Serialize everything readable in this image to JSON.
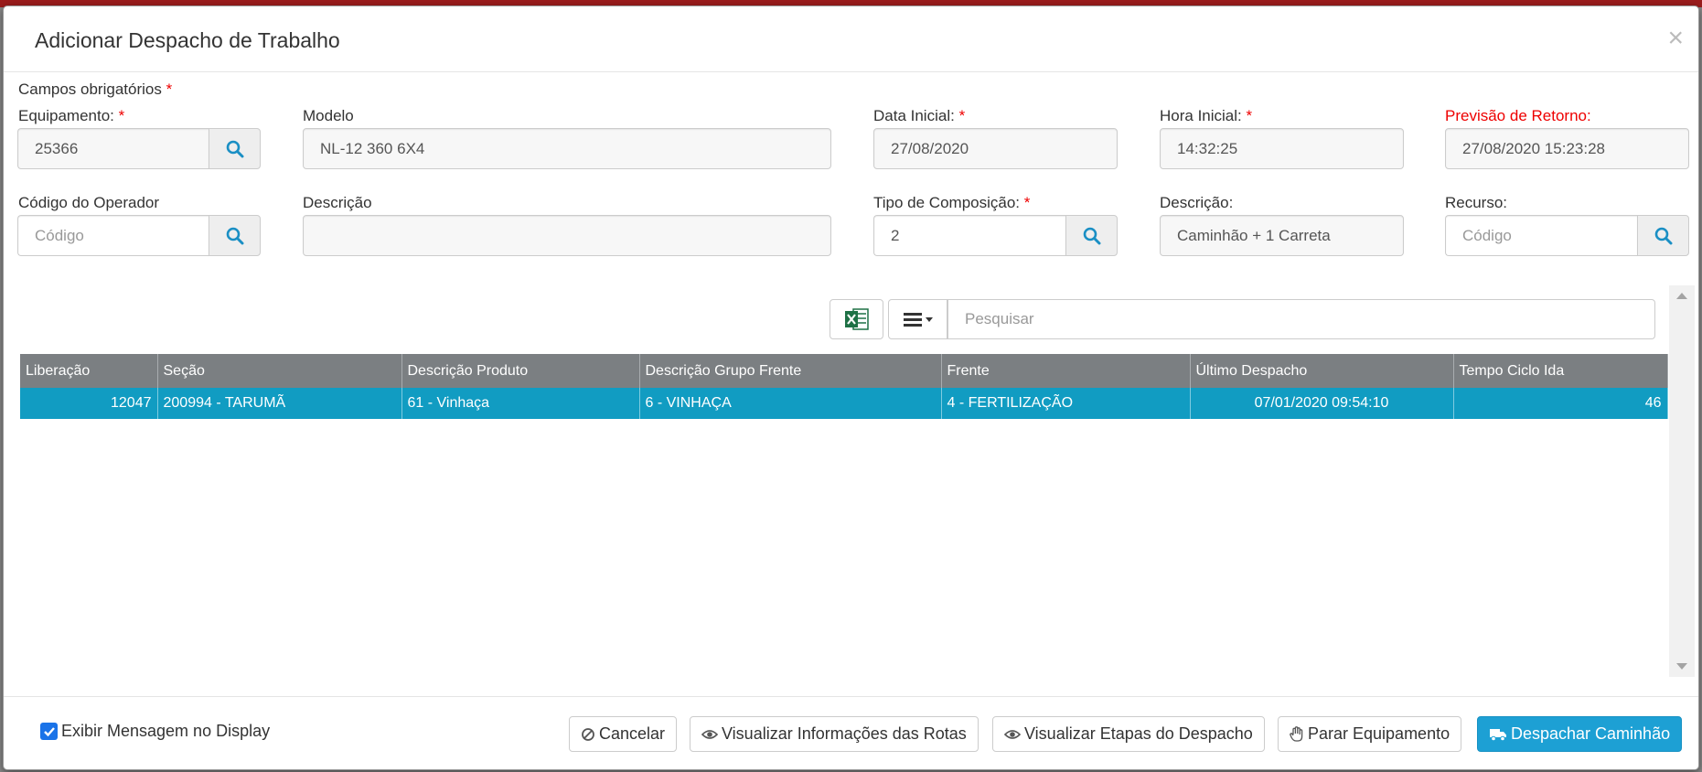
{
  "modal": {
    "title": "Adicionar Despacho de Trabalho",
    "close_label": "×",
    "required_note": "Campos obrigatórios",
    "required_star": "*"
  },
  "form": {
    "equipamento": {
      "label": "Equipamento:",
      "value": "25366"
    },
    "modelo": {
      "label": "Modelo",
      "value": "NL-12 360 6X4"
    },
    "data_inicial": {
      "label": "Data Inicial:",
      "value": "27/08/2020"
    },
    "hora_inicial": {
      "label": "Hora Inicial:",
      "value": "14:32:25"
    },
    "previsao_retorno": {
      "label": "Previsão de Retorno:",
      "value": "27/08/2020 15:23:28",
      "label_color": "#e00000"
    },
    "codigo_operador": {
      "label": "Código do Operador",
      "placeholder": "Código"
    },
    "descricao": {
      "label": "Descrição",
      "value": ""
    },
    "tipo_composicao": {
      "label": "Tipo de Composição:",
      "value": "2"
    },
    "descricao_composicao": {
      "label": "Descrição:",
      "value": "Caminhão + 1 Carreta"
    },
    "recurso": {
      "label": "Recurso:",
      "placeholder": "Código"
    }
  },
  "toolbar": {
    "excel_icon": "excel-icon",
    "columns_icon": "list-menu-icon",
    "search_placeholder": "Pesquisar"
  },
  "grid": {
    "columns": [
      "Liberação",
      "Seção",
      "Descrição Produto",
      "Descrição Grupo Frente",
      "Frente",
      "Último Despacho",
      "Tempo Ciclo Ida"
    ],
    "rows": [
      [
        "12047",
        "200994 - TARUMÃ",
        "61 - Vinhaça",
        "6 - VINHAÇA",
        "4 - FERTILIZAÇÃO",
        "07/01/2020 09:54:10",
        "46"
      ]
    ],
    "selected_row_color": "#119cc2"
  },
  "footer": {
    "checkbox_label": "Exibir Mensagem no Display",
    "checkbox_checked": true,
    "buttons": {
      "cancelar": "Cancelar",
      "visualizar_rotas": "Visualizar Informações das Rotas",
      "visualizar_etapas": "Visualizar Etapas do Despacho",
      "parar_equipamento": "Parar Equipamento",
      "despachar_caminhao": "Despachar Caminhão"
    }
  },
  "colors": {
    "accent": "#1da0d4",
    "header_gray": "#7b7f82",
    "required_red": "#e00000"
  }
}
